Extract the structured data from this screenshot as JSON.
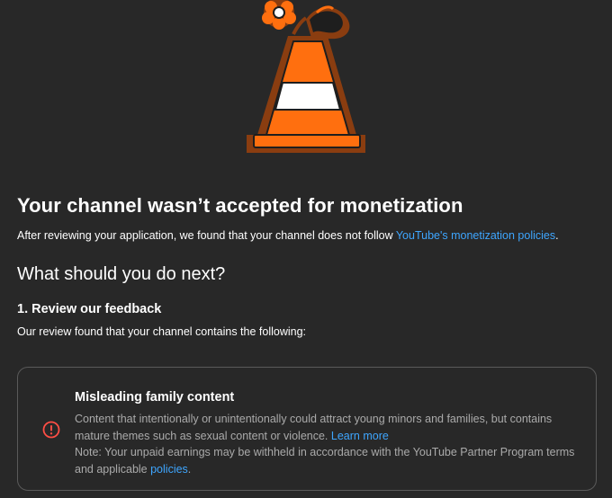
{
  "colors": {
    "background": "#282828",
    "link": "#3ea6ff",
    "muted_text": "#aaaaaa",
    "error": "#ff4e45",
    "cone_orange": "#ff6f0f",
    "cone_outline": "#8a3d10"
  },
  "header": {
    "title": "Your channel wasn’t accepted for monetization",
    "subtitle_prefix": "After reviewing your application, we found that your channel does not follow ",
    "subtitle_link": "YouTube's monetization policies",
    "subtitle_suffix": "."
  },
  "next_steps": {
    "heading": "What should you do next?",
    "step1_heading": "1. Review our feedback",
    "step1_description": "Our review found that your channel contains the following:"
  },
  "feedback_card": {
    "icon": "error-circle-icon",
    "title": "Misleading family content",
    "description": "Content that intentionally or unintentionally could attract young minors and families, but contains mature themes such as sexual content or violence.",
    "learn_more": "Learn more",
    "note_prefix": "Note: Your unpaid earnings may be withheld in accordance with the YouTube Partner Program terms and applicable ",
    "note_link": "policies",
    "note_suffix": "."
  },
  "illustration": {
    "icon": "traffic-cone-with-flower-icon"
  }
}
